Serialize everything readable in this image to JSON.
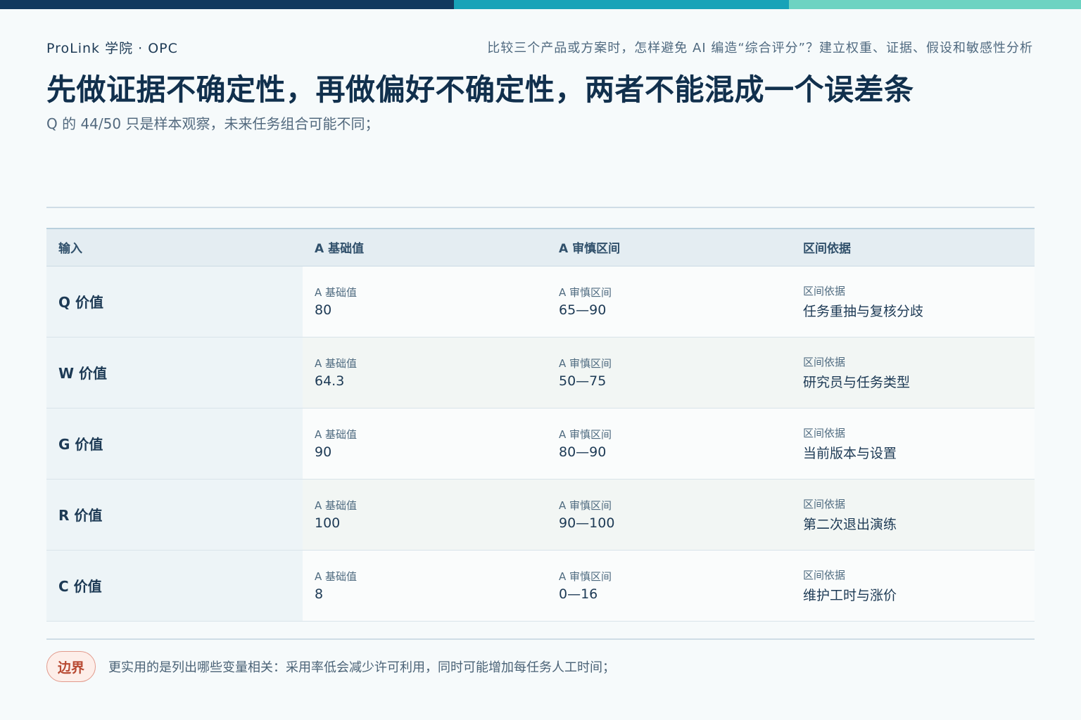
{
  "header": {
    "brand": "ProLink 学院 · OPC",
    "series": "比较三个产品或方案时，怎样避免 AI 编造“综合评分”？建立权重、证据、假设和敏感性分析",
    "title": "先做证据不确定性，再做偏好不确定性，两者不能混成一个误差条",
    "subtitle": "Q 的 44/50 只是样本观察，未来任务组合可能不同；"
  },
  "colors": {
    "topbar": [
      "#12395e",
      "#18a3b8",
      "#6dd3c2"
    ],
    "badge": "#b84a33"
  },
  "table": {
    "columns": [
      "输入",
      "A 基础值",
      "A 审慎区间",
      "区间依据"
    ],
    "rows": [
      {
        "input": "Q 价值",
        "base_label": "A 基础值",
        "base": "80",
        "range_label": "A 审慎区间",
        "range": "65—90",
        "basis_label": "区间依据",
        "basis": "任务重抽与复核分歧"
      },
      {
        "input": "W 价值",
        "base_label": "A 基础值",
        "base": "64.3",
        "range_label": "A 审慎区间",
        "range": "50—75",
        "basis_label": "区间依据",
        "basis": "研究员与任务类型"
      },
      {
        "input": "G 价值",
        "base_label": "A 基础值",
        "base": "90",
        "range_label": "A 审慎区间",
        "range": "80—90",
        "basis_label": "区间依据",
        "basis": "当前版本与设置"
      },
      {
        "input": "R 价值",
        "base_label": "A 基础值",
        "base": "100",
        "range_label": "A 审慎区间",
        "range": "90—100",
        "basis_label": "区间依据",
        "basis": "第二次退出演练"
      },
      {
        "input": "C 价值",
        "base_label": "A 基础值",
        "base": "8",
        "range_label": "A 审慎区间",
        "range": "0—16",
        "basis_label": "区间依据",
        "basis": "维护工时与涨价"
      }
    ]
  },
  "footer": {
    "badge": "边界",
    "note": "更实用的是列出哪些变量相关：采用率低会减少许可利用，同时可能增加每任务人工时间；"
  }
}
